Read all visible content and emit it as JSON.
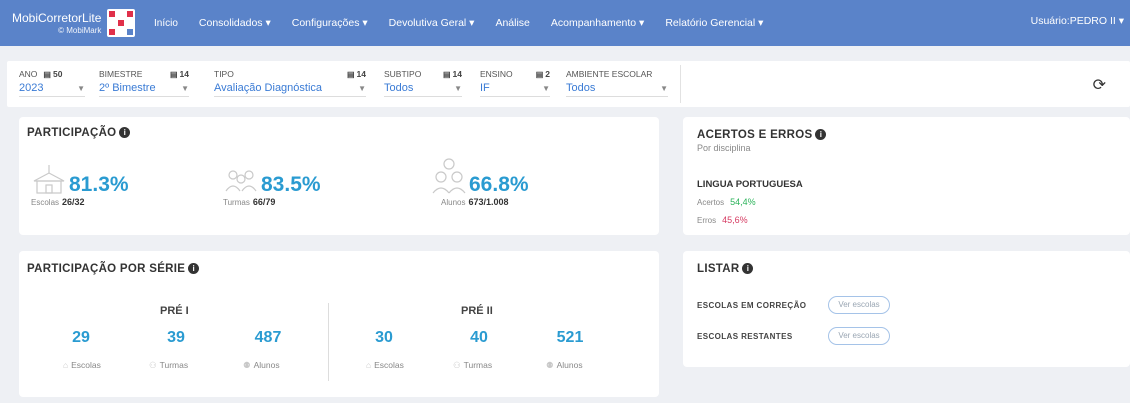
{
  "navbar": {
    "brand_name": "MobiCorretorLite",
    "brand_sub": "© MobiMark",
    "items": [
      {
        "label": "Início"
      },
      {
        "label": "Consolidados ▾"
      },
      {
        "label": "Configurações ▾"
      },
      {
        "label": "Devolutiva Geral ▾"
      },
      {
        "label": "Análise"
      },
      {
        "label": "Acompanhamento ▾"
      },
      {
        "label": "Relatório Gerencial ▾"
      }
    ],
    "user": "Usuário:PEDRO II ▾"
  },
  "filters": [
    {
      "label": "ANO",
      "count": "50",
      "value": "2023"
    },
    {
      "label": "BIMESTRE",
      "count": "14",
      "value": "2º Bimestre"
    },
    {
      "label": "TIPO",
      "count": "14",
      "value": "Avaliação Diagnóstica"
    },
    {
      "label": "SUBTIPO",
      "count": "14",
      "value": "Todos"
    },
    {
      "label": "ENSINO",
      "count": "2",
      "value": "IF"
    },
    {
      "label": "AMBIENTE ESCOLAR",
      "count": "",
      "value": "Todos"
    }
  ],
  "participacao": {
    "title": "PARTICIPAÇÃO",
    "stats": [
      {
        "value": "81.3%",
        "label": "Escolas",
        "detail": "26/32"
      },
      {
        "value": "83.5%",
        "label": "Turmas",
        "detail": "66/79"
      },
      {
        "value": "66.8%",
        "label": "Alunos",
        "detail": "673/1.008"
      }
    ]
  },
  "acertos": {
    "title": "ACERTOS E ERROS",
    "subtitle": "Por disciplina",
    "discipline": "LINGUA PORTUGUESA",
    "acertos_label": "Acertos",
    "acertos_value": "54,4%",
    "erros_label": "Erros",
    "erros_value": "45,6%"
  },
  "serie": {
    "title": "PARTICIPAÇÃO POR SÉRIE",
    "groups": [
      {
        "name": "PRÉ I",
        "escolas": "29",
        "turmas": "39",
        "alunos": "487"
      },
      {
        "name": "PRÉ II",
        "escolas": "30",
        "turmas": "40",
        "alunos": "521"
      }
    ],
    "lbl_escolas": "Escolas",
    "lbl_turmas": "Turmas",
    "lbl_alunos": "Alunos"
  },
  "listar": {
    "title": "LISTAR",
    "rows": [
      {
        "label": "ESCOLAS EM CORREÇÃO",
        "button": "Ver escolas"
      },
      {
        "label": "ESCOLAS RESTANTES",
        "button": "Ver escolas"
      }
    ]
  },
  "colors": {
    "nav": "#5a83c9",
    "accent": "#2a9bd1",
    "green": "#2bb35a",
    "red": "#d63b62"
  }
}
